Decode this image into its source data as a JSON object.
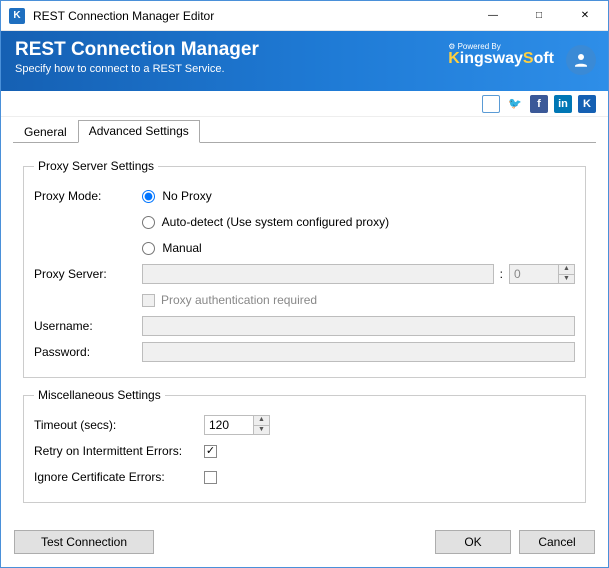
{
  "window": {
    "title": "REST Connection Manager Editor"
  },
  "banner": {
    "heading": "REST Connection Manager",
    "subheading": "Specify how to connect to a REST Service.",
    "powered_by": "Powered By",
    "brand": "KingswaySoft"
  },
  "tabs": {
    "general": "General",
    "advanced": "Advanced Settings",
    "active": "advanced"
  },
  "proxy": {
    "legend": "Proxy Server Settings",
    "mode_label": "Proxy Mode:",
    "options": {
      "no_proxy": "No Proxy",
      "auto": "Auto-detect (Use system configured proxy)",
      "manual": "Manual"
    },
    "selected_mode": "no_proxy",
    "server_label": "Proxy Server:",
    "server_value": "",
    "port_value": "0",
    "auth_label": "Proxy authentication required",
    "auth_checked": false,
    "username_label": "Username:",
    "username_value": "",
    "password_label": "Password:",
    "password_value": ""
  },
  "misc": {
    "legend": "Miscellaneous Settings",
    "timeout_label": "Timeout (secs):",
    "timeout_value": "120",
    "retry_label": "Retry on Intermittent Errors:",
    "retry_checked": true,
    "ignore_cert_label": "Ignore Certificate Errors:",
    "ignore_cert_checked": false
  },
  "buttons": {
    "test": "Test Connection",
    "ok": "OK",
    "cancel": "Cancel"
  }
}
